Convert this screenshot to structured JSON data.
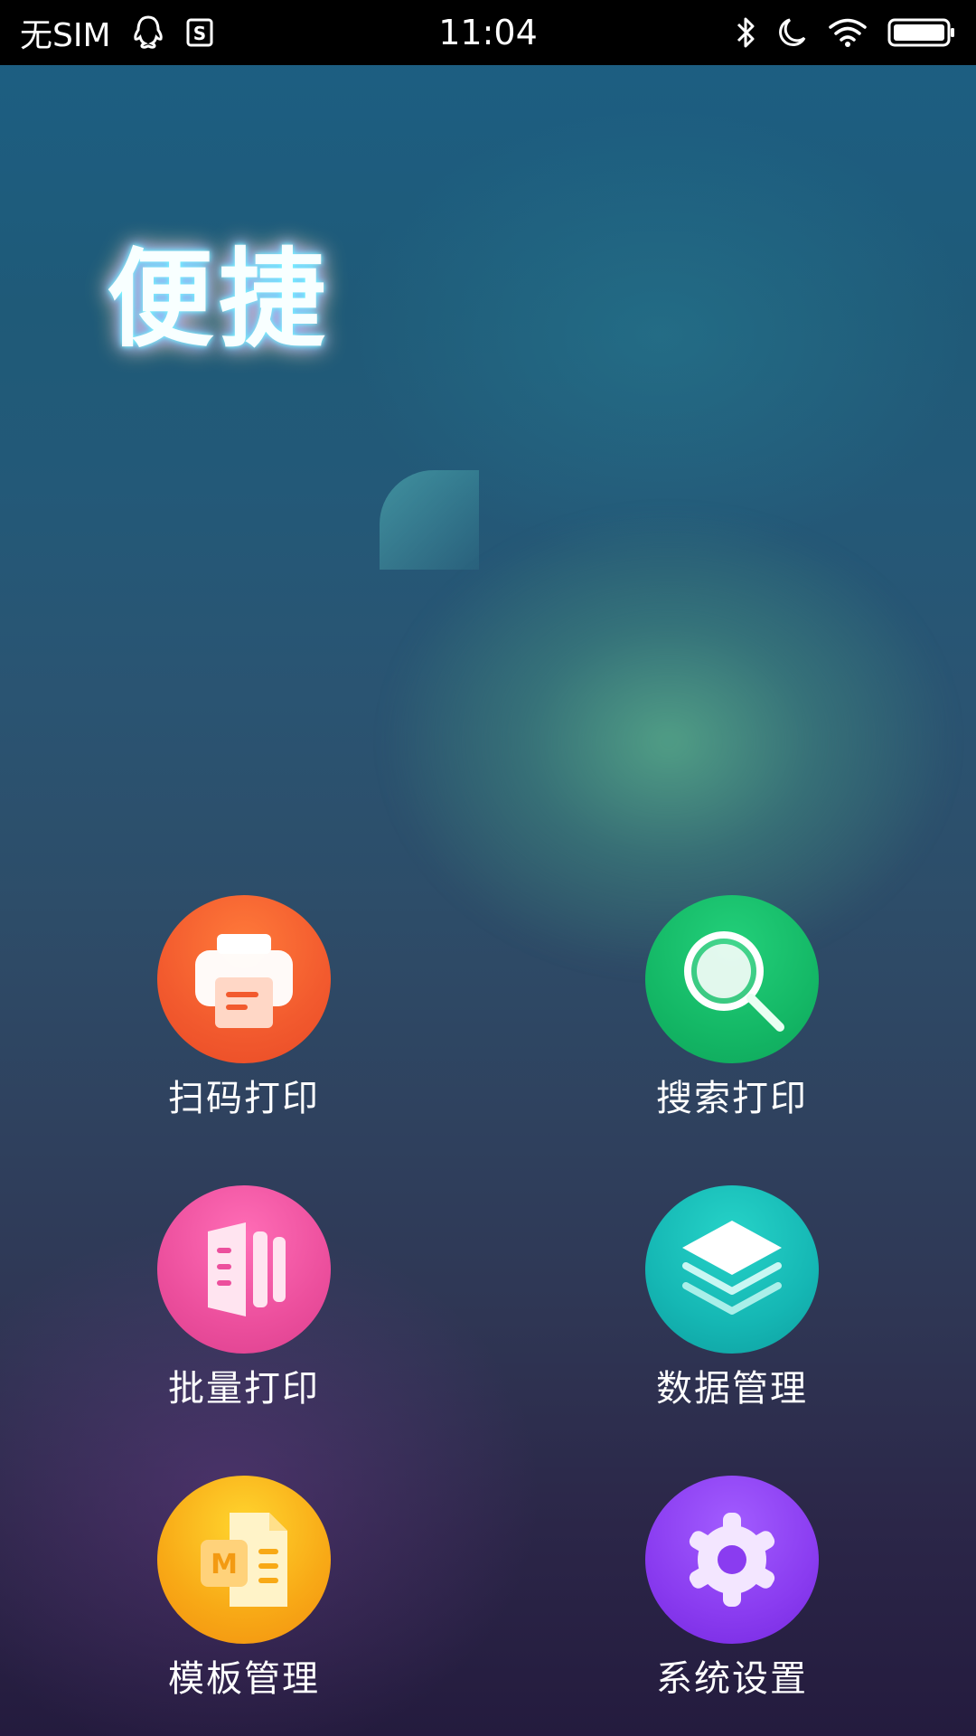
{
  "status_bar": {
    "carrier": "无SIM",
    "time": "11:04"
  },
  "app": {
    "logo_text": "便捷"
  },
  "tiles": [
    {
      "label": "扫码打印",
      "icon": "printer-icon",
      "color": "#f25a2e"
    },
    {
      "label": "搜索打印",
      "icon": "search-icon",
      "color": "#14b866"
    },
    {
      "label": "批量打印",
      "icon": "batch-document-icon",
      "color": "#ec4f9d"
    },
    {
      "label": "数据管理",
      "icon": "layers-icon",
      "color": "#15b7b4"
    },
    {
      "label": "模板管理",
      "icon": "template-document-icon",
      "color": "#f8a916"
    },
    {
      "label": "系统设置",
      "icon": "gear-icon",
      "color": "#8a3cf0"
    }
  ]
}
